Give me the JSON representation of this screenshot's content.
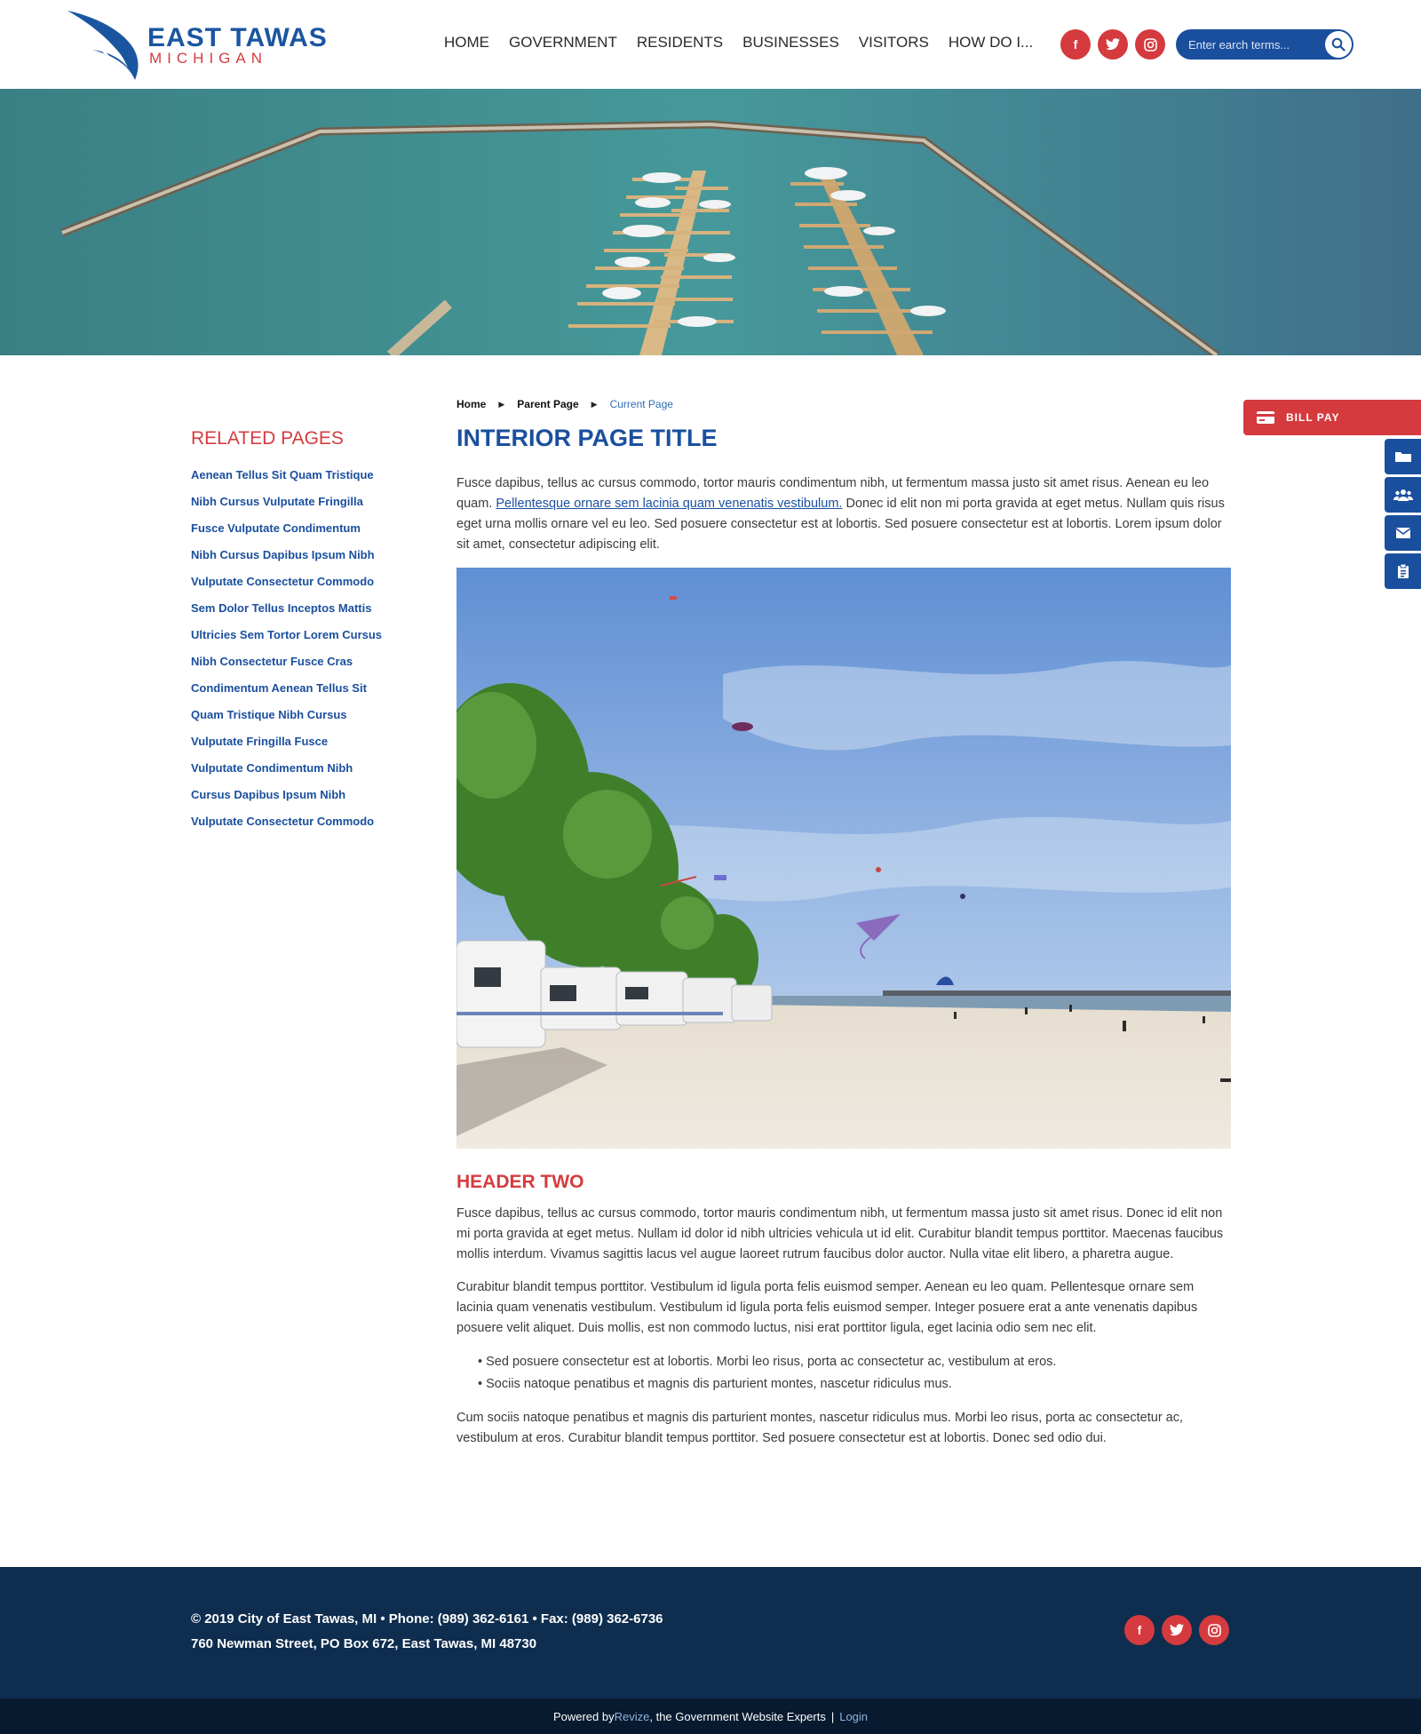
{
  "header": {
    "logo_title": "EAST TAWAS",
    "logo_subtitle": "MICHIGAN",
    "nav": [
      {
        "label": "HOME"
      },
      {
        "label": "GOVERNMENT"
      },
      {
        "label": "RESIDENTS"
      },
      {
        "label": "BUSINESSES"
      },
      {
        "label": "VISITORS"
      },
      {
        "label": "HOW DO I..."
      }
    ],
    "social": [
      {
        "icon": "facebook-icon",
        "glyph": "f"
      },
      {
        "icon": "twitter-icon",
        "glyph": "t"
      },
      {
        "icon": "instagram-icon",
        "glyph": "◎"
      }
    ],
    "search_placeholder": "Enter earch terms..."
  },
  "breadcrumb": [
    {
      "label": "Home"
    },
    {
      "label": "Parent Page"
    },
    {
      "label": "Current Page"
    }
  ],
  "sidebar": {
    "title": "RELATED PAGES",
    "links": [
      "Aenean Tellus Sit Quam Tristique",
      "Nibh Cursus Vulputate Fringilla",
      "Fusce Vulputate Condimentum",
      "Nibh Cursus Dapibus Ipsum Nibh",
      "Vulputate Consectetur Commodo",
      "Sem Dolor Tellus Inceptos Mattis",
      "Ultricies Sem Tortor Lorem Cursus",
      "Nibh Consectetur Fusce Cras",
      "Condimentum Aenean Tellus Sit",
      "Quam Tristique Nibh Cursus",
      "Vulputate Fringilla Fusce",
      "Vulputate Condimentum Nibh",
      "Cursus Dapibus Ipsum Nibh",
      "Vulputate Consectetur Commodo"
    ]
  },
  "main": {
    "title": "INTERIOR PAGE TITLE",
    "intro_before": "Fusce dapibus, tellus ac cursus commodo, tortor mauris condimentum nibh, ut fermentum massa justo sit amet risus. Aenean eu leo quam. ",
    "intro_link": "Pellentesque ornare sem lacinia quam venenatis vestibulum.",
    "intro_after": " Donec id elit non mi porta gravida at eget metus. Nullam quis risus eget urna mollis ornare vel eu leo. Sed posuere consectetur est at lobortis. Sed posuere consectetur est at lobortis. Lorem ipsum dolor sit amet, consectetur adipiscing elit.",
    "header_two": "HEADER TWO",
    "para2": "Fusce dapibus, tellus ac cursus commodo, tortor mauris condimentum nibh, ut fermentum massa justo sit amet risus. Donec id elit non mi porta gravida at eget metus. Nullam id dolor id nibh ultricies vehicula ut id elit. Curabitur blandit tempus porttitor. Maecenas faucibus mollis interdum. Vivamus sagittis lacus vel augue laoreet rutrum faucibus dolor auctor. Nulla vitae elit libero, a pharetra augue.",
    "para3": "Curabitur blandit tempus porttitor. Vestibulum id ligula porta felis euismod semper. Aenean eu leo quam. Pellentesque ornare sem lacinia quam venenatis vestibulum. Vestibulum id ligula porta felis euismod semper. Integer posuere erat a ante venenatis dapibus posuere velit aliquet. Duis mollis, est non commodo luctus, nisi erat porttitor ligula, eget lacinia odio sem nec elit.",
    "bullets": [
      "Sed posuere consectetur est at lobortis. Morbi leo risus, porta ac consectetur ac, vestibulum at eros.",
      "Sociis natoque penatibus et magnis dis parturient montes, nascetur ridiculus mus."
    ],
    "para4": "Cum sociis natoque penatibus et magnis dis parturient montes, nascetur ridiculus mus. Morbi leo risus, porta ac consectetur ac, vestibulum at eros. Curabitur blandit tempus porttitor. Sed posuere consectetur est at lobortis. Donec sed odio dui."
  },
  "quick_links": {
    "bill_pay": "BILL PAY",
    "icons": [
      "folder-icon",
      "users-icon",
      "envelope-icon",
      "clipboard-icon"
    ]
  },
  "footer": {
    "line1": "© 2019 City of East Tawas, MI  •  Phone: (989) 362-6161  •  Fax: (989) 362-6736",
    "line2": "760 Newman Street, PO Box 672, East Tawas, MI 48730",
    "powered_prefix": "Powered by ",
    "powered_brand": "Revize",
    "powered_suffix": ", the Government Website Experts",
    "powered_sep": "|",
    "login": "Login"
  },
  "colors": {
    "brand_blue": "#1a4f9e",
    "brand_red": "#d43c3f",
    "footer_navy": "#0e2d4f"
  }
}
